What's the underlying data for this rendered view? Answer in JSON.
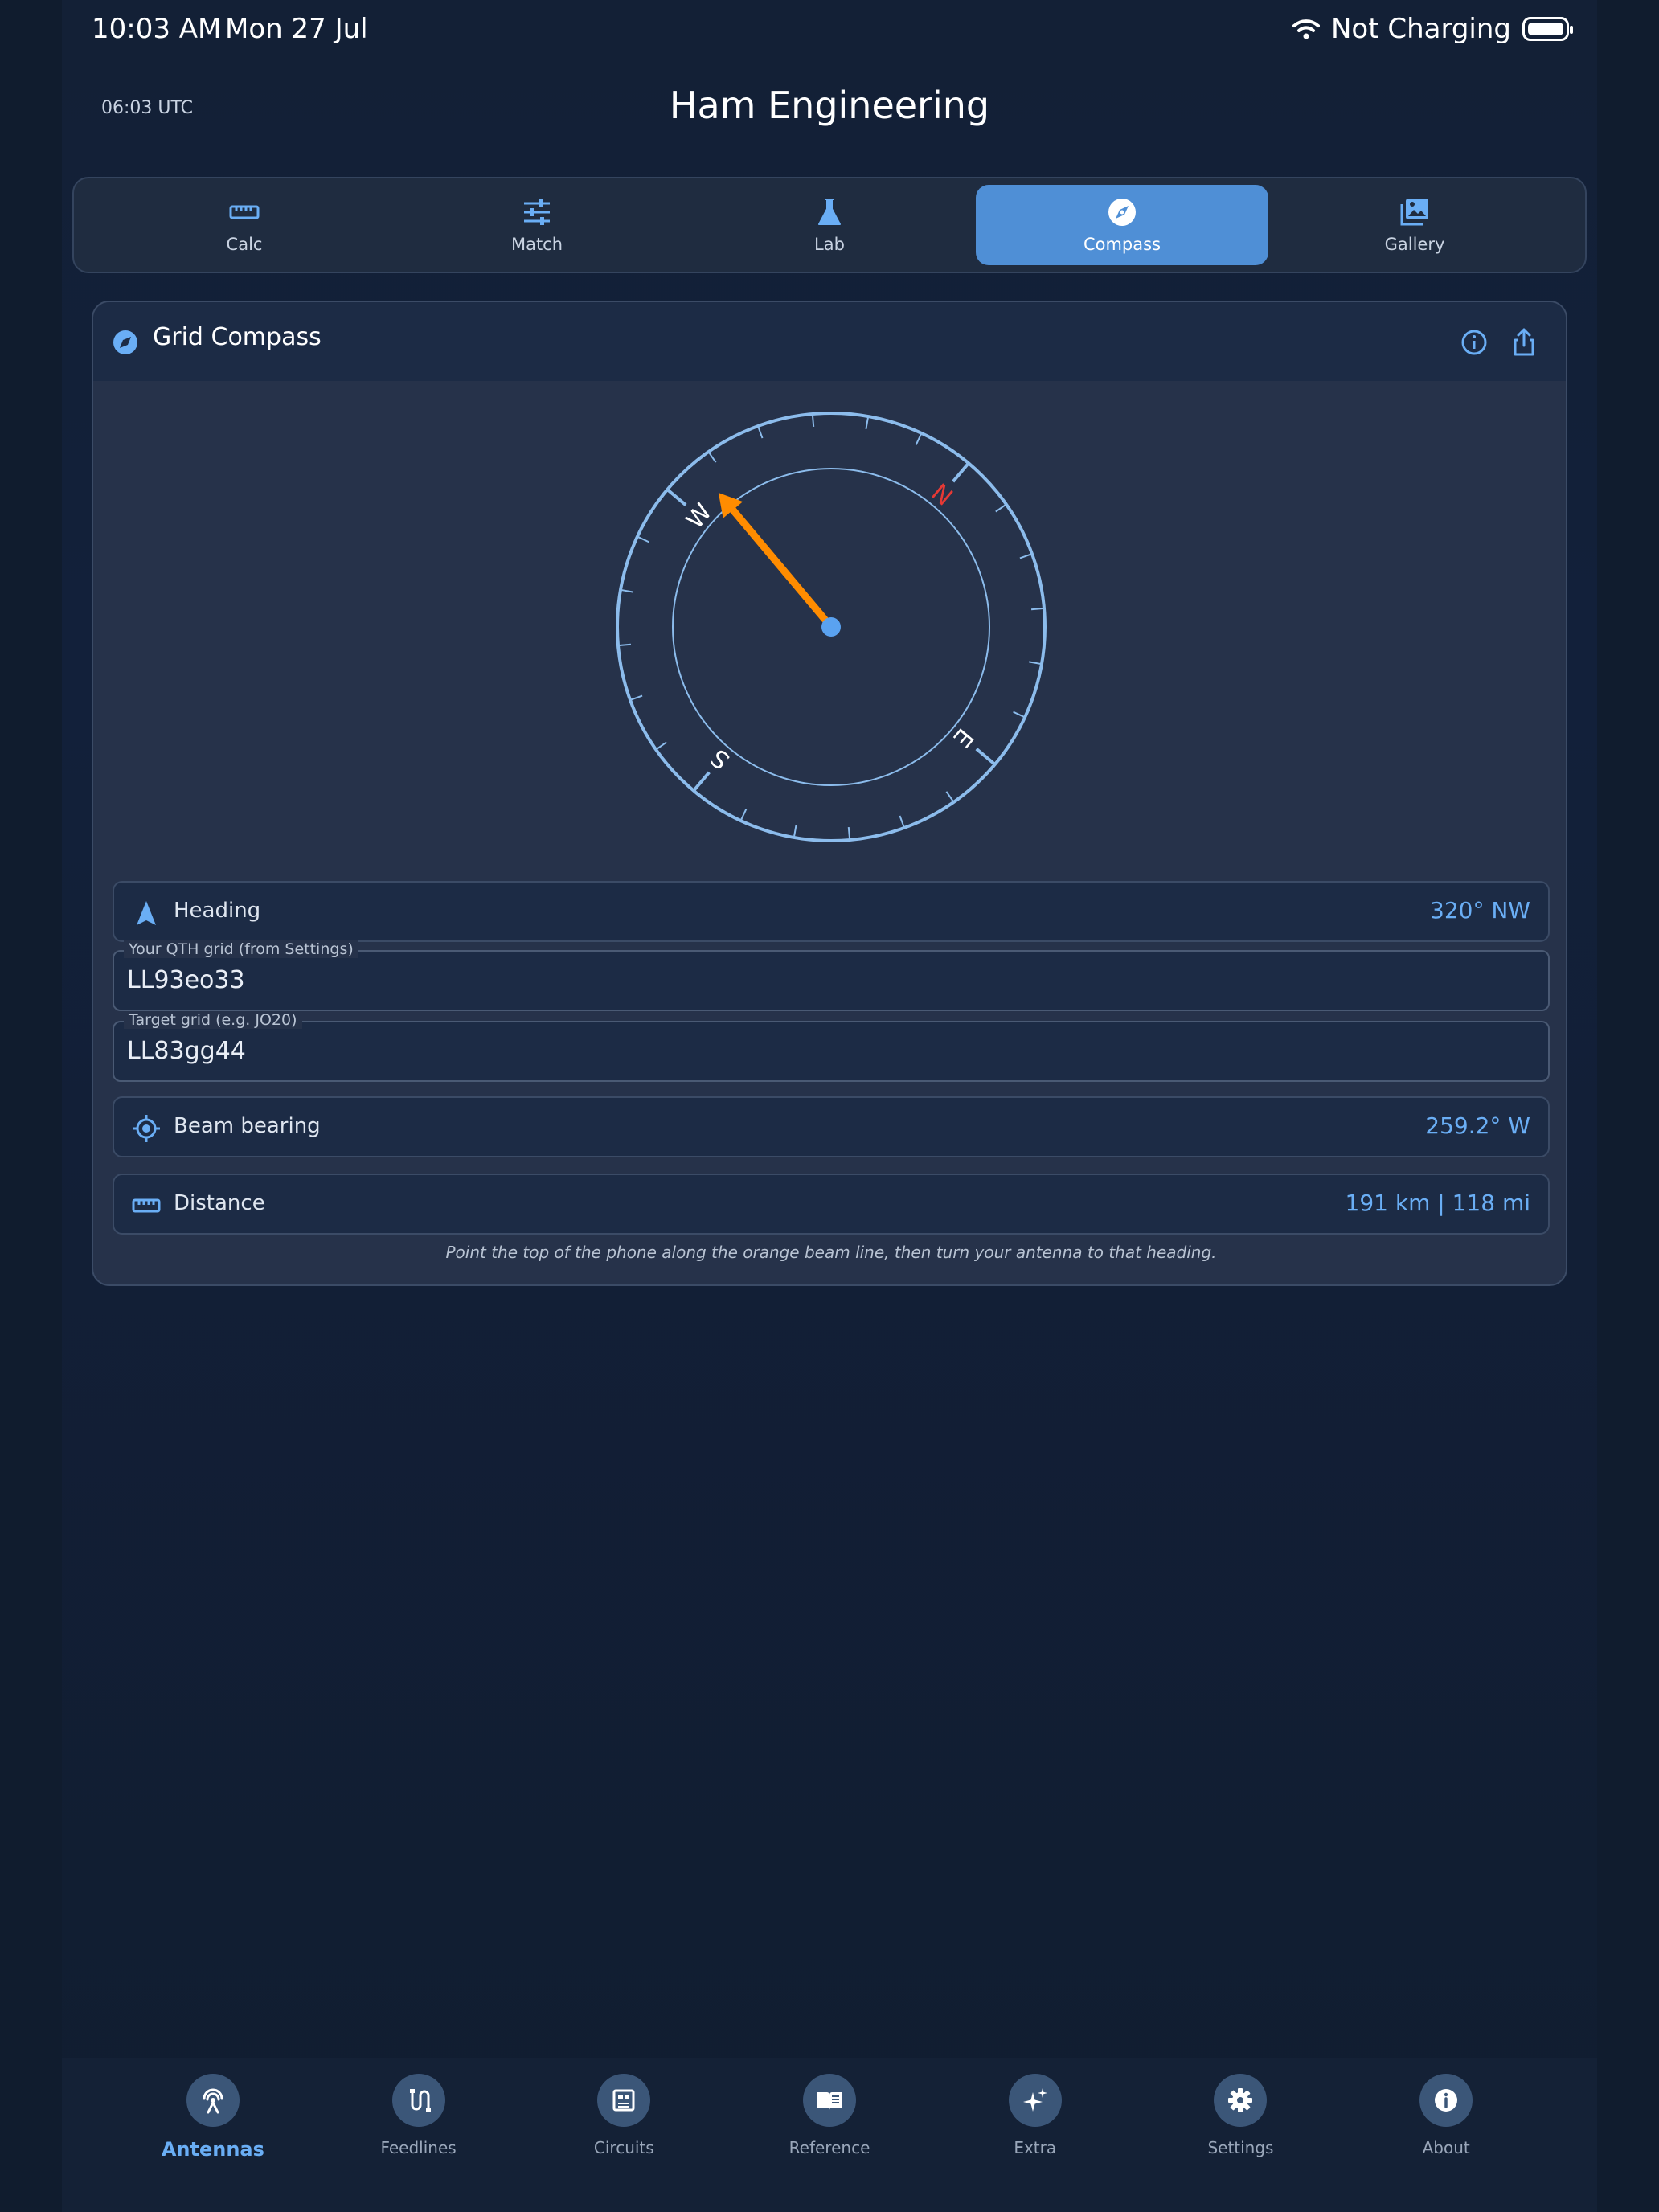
{
  "status_bar": {
    "time": "10:03 AM",
    "date": "Mon 27 Jul",
    "charging": "Not Charging"
  },
  "header": {
    "utc": "06:03 UTC",
    "title": "Ham Engineering"
  },
  "tabs": [
    {
      "label": "Calc",
      "icon": "ruler-icon"
    },
    {
      "label": "Match",
      "icon": "sliders-icon"
    },
    {
      "label": "Lab",
      "icon": "flask-icon"
    },
    {
      "label": "Compass",
      "icon": "compass-icon",
      "active": true
    },
    {
      "label": "Gallery",
      "icon": "gallery-icon"
    }
  ],
  "card": {
    "title": "Grid Compass",
    "compass": {
      "heading_deg": 320,
      "labels": {
        "N": "N",
        "E": "E",
        "S": "S",
        "W": "W"
      }
    },
    "heading": {
      "label": "Heading",
      "value": "320°  NW"
    },
    "qth_grid": {
      "legend": "Your QTH grid (from Settings)",
      "value": "LL93eo33"
    },
    "target_grid": {
      "legend": "Target grid (e.g. JO20)",
      "value": "LL83gg44"
    },
    "beam_bearing": {
      "label": "Beam bearing",
      "value": "259.2°  W"
    },
    "distance": {
      "label": "Distance",
      "value": "191 km  |  118 mi"
    },
    "hint": "Point the top of the phone along the orange beam line, then turn your antenna to that heading."
  },
  "bottom_nav": [
    {
      "label": "Antennas",
      "icon": "antenna-icon",
      "active": true
    },
    {
      "label": "Feedlines",
      "icon": "feedline-icon"
    },
    {
      "label": "Circuits",
      "icon": "circuit-icon"
    },
    {
      "label": "Reference",
      "icon": "book-icon"
    },
    {
      "label": "Extra",
      "icon": "sparkle-icon"
    },
    {
      "label": "Settings",
      "icon": "gear-icon"
    },
    {
      "label": "About",
      "icon": "info-icon"
    }
  ],
  "colors": {
    "accent": "#4f8fd6",
    "value_blue": "#6aaef5",
    "beam_orange": "#ff8c00",
    "north_red": "#e53935"
  }
}
